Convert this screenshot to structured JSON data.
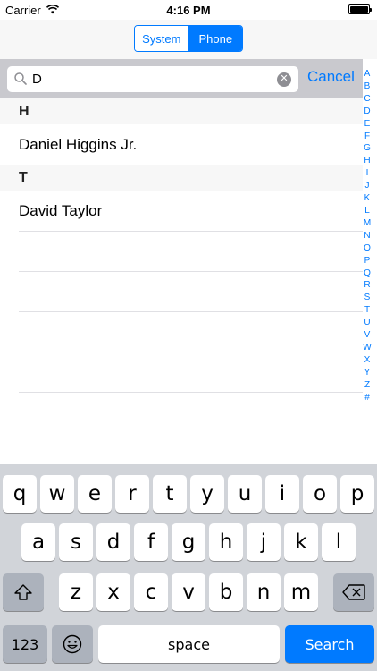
{
  "status": {
    "carrier": "Carrier",
    "time": "4:16 PM"
  },
  "nav": {
    "segments": [
      "System",
      "Phone"
    ],
    "selected": "Phone"
  },
  "search": {
    "value": "D",
    "cancel_label": "Cancel"
  },
  "sections": [
    {
      "header": "H",
      "rows": [
        "Daniel Higgins Jr."
      ]
    },
    {
      "header": "T",
      "rows": [
        "David Taylor"
      ]
    }
  ],
  "index": [
    "A",
    "B",
    "C",
    "D",
    "E",
    "F",
    "G",
    "H",
    "I",
    "J",
    "K",
    "L",
    "M",
    "N",
    "O",
    "P",
    "Q",
    "R",
    "S",
    "T",
    "U",
    "V",
    "W",
    "X",
    "Y",
    "Z",
    "#"
  ],
  "keyboard": {
    "row1": [
      "q",
      "w",
      "e",
      "r",
      "t",
      "y",
      "u",
      "i",
      "o",
      "p"
    ],
    "row2": [
      "a",
      "s",
      "d",
      "f",
      "g",
      "h",
      "j",
      "k",
      "l"
    ],
    "row3": [
      "z",
      "x",
      "c",
      "v",
      "b",
      "n",
      "m"
    ],
    "numbers_label": "123",
    "space_label": "space",
    "search_label": "Search"
  },
  "colors": {
    "accent": "#007aff",
    "keyboard_bg": "#d1d4d9",
    "search_bar_bg": "#c9c9ce"
  }
}
